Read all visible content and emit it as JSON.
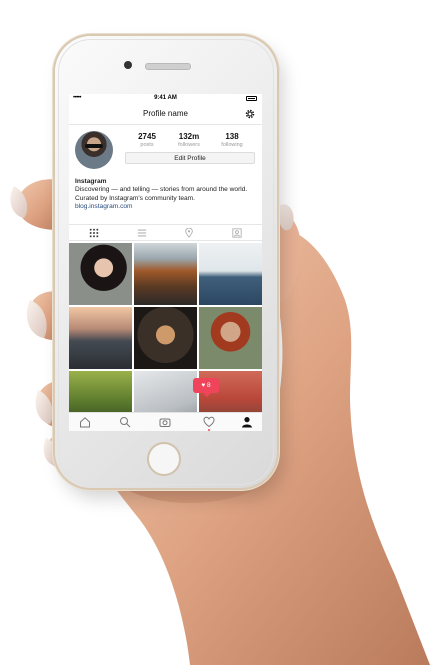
{
  "status_bar": {
    "signal": "•••••",
    "time": "9:41 AM"
  },
  "nav": {
    "title": "Profile name"
  },
  "profile": {
    "stats": [
      {
        "value": "2745",
        "label": "posts"
      },
      {
        "value": "132m",
        "label": "followers"
      },
      {
        "value": "138",
        "label": "following"
      }
    ],
    "edit_button": "Edit Profile",
    "bio": {
      "name": "Instagram",
      "text": "Discovering — and telling — stories from around the world. Curated by Instagram's community team.",
      "link": "blog.instagram.com"
    }
  },
  "tabs": [
    "grid-icon",
    "list-icon",
    "location-pin-icon",
    "tagged-person-icon"
  ],
  "notification": {
    "likes": "8"
  },
  "bottom_nav": [
    "home-icon",
    "search-icon",
    "camera-icon",
    "heart-icon",
    "profile-icon"
  ],
  "colors": {
    "accent": "#f0445a",
    "link": "#264b7a"
  }
}
